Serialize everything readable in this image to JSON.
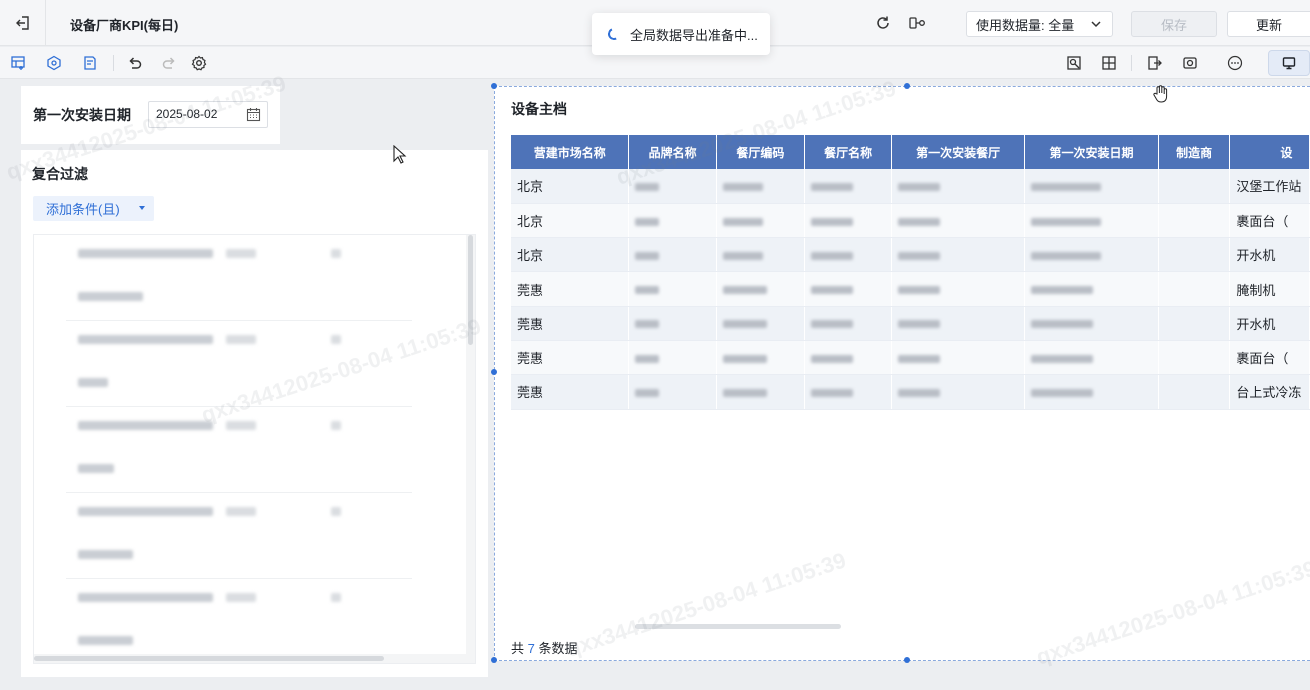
{
  "header": {
    "title": "设备厂商KPI(每日)",
    "toast": "全局数据导出准备中...",
    "data_select_label": "使用数据量: 全量",
    "save_label": "保存",
    "update_label": "更新"
  },
  "date_filter": {
    "label": "第一次安装日期",
    "value": "2025-08-02"
  },
  "compound_filter": {
    "title": "复合过滤",
    "add_label": "添加条件(且)"
  },
  "table": {
    "title": "设备主档",
    "columns": [
      "营建市场名称",
      "品牌名称",
      "餐厅编码",
      "餐厅名称",
      "第一次安装餐厅",
      "第一次安装日期",
      "制造商",
      "设"
    ],
    "rows": [
      {
        "market": "北京",
        "device": "汉堡工作站"
      },
      {
        "market": "北京",
        "device": "裹面台（"
      },
      {
        "market": "北京",
        "device": "开水机"
      },
      {
        "market": "莞惠",
        "device": "腌制机"
      },
      {
        "market": "莞惠",
        "device": "开水机"
      },
      {
        "market": "莞惠",
        "device": "裹面台（"
      },
      {
        "market": "莞惠",
        "device": "台上式冷冻"
      }
    ],
    "footer_prefix": "共",
    "footer_count": "7",
    "footer_suffix": "条数据"
  },
  "watermark_text": "qxx34412025-08-04 11:05:39",
  "colors": {
    "accent": "#2f6fd6",
    "table_header": "#4e73b8"
  }
}
